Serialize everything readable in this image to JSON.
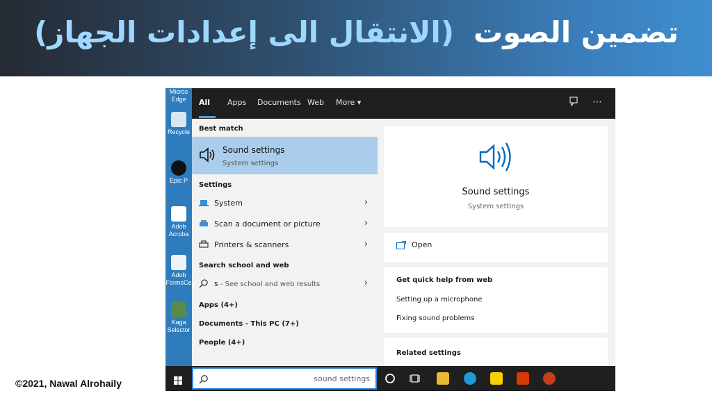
{
  "slide": {
    "title_part1": "تضمين الصوت",
    "title_part2": "(الانتقال الى إعدادات الجهاز)",
    "copyright": "©2021, Nawal Alrohaily"
  },
  "desktop_icons": [
    {
      "label": "Micros Edge"
    },
    {
      "label": "Recycle"
    },
    {
      "label": "Epic P"
    },
    {
      "label": "Adob Acroba"
    },
    {
      "label": "Adob FormsCe"
    },
    {
      "label": "Kaga Selector"
    }
  ],
  "search_tabs": [
    "All",
    "Apps",
    "Documents",
    "Web",
    "More ▾"
  ],
  "left_panel": {
    "best_match_label": "Best match",
    "best_match": {
      "title": "Sound settings",
      "subtitle": "System settings"
    },
    "settings_label": "Settings",
    "settings_items": [
      {
        "label": "System",
        "icon": "laptop-icon"
      },
      {
        "label": "Scan a document or picture",
        "icon": "scanner-icon"
      },
      {
        "label": "Printers & scanners",
        "icon": "printer-icon"
      }
    ],
    "web_label": "Search school and web",
    "web_item": {
      "query": "s",
      "suffix": " - See school and web results"
    },
    "categories": [
      "Apps (4+)",
      "Documents - This PC (7+)",
      "People (4+)"
    ]
  },
  "right_panel": {
    "title": "Sound settings",
    "subtitle": "System settings",
    "open_label": "Open",
    "help_heading": "Get quick help from web",
    "help_links": [
      "Setting up a microphone",
      "Fixing sound problems"
    ],
    "related_heading": "Related settings"
  },
  "taskbar": {
    "search_value": "sound settings"
  },
  "colors": {
    "accent": "#0067c0",
    "highlight": "#a9cdea",
    "banner_title": "#ffffff",
    "banner_subtitle": "#9ed8ff"
  }
}
